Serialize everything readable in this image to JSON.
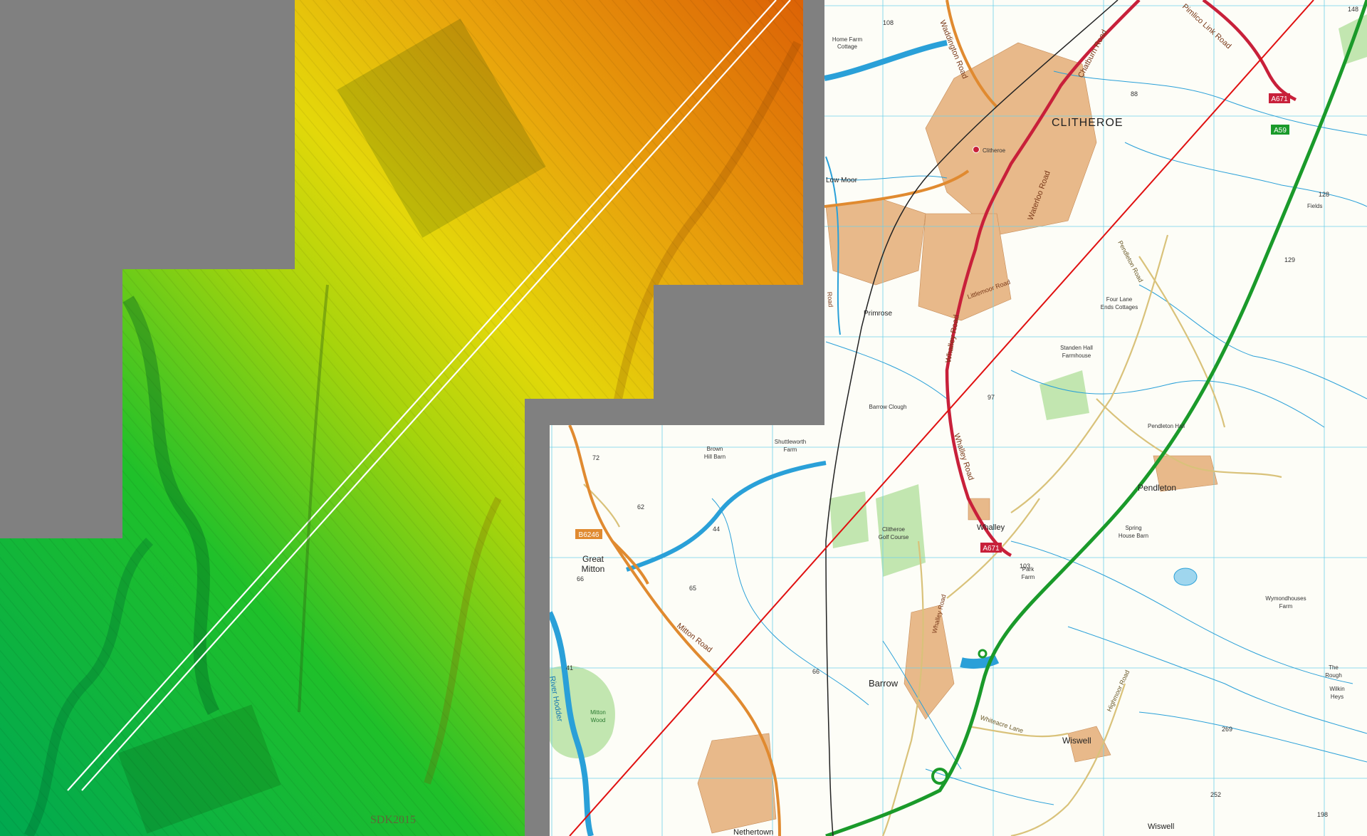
{
  "lidar_panel": {
    "watermark": "SDK2015",
    "colors": {
      "low": "#00b040",
      "mid": "#e8e000",
      "high": "#e0700a",
      "nodata": "#808080"
    }
  },
  "map_panel": {
    "colors": {
      "paper": "#fdfdf7",
      "grid": "#6fd0e8",
      "water": "#2aa0d8",
      "a_road": "#c8203a",
      "b_road": "#e08a30",
      "trunk": "#1a9a2a",
      "rail": "#222222",
      "pipeline": "#e01010",
      "urban": "#e8b98a",
      "woodland": "#c2e6b0"
    },
    "towns": {
      "clitheroe": "CLITHEROE",
      "barrow": "Barrow",
      "whalley": "Whalley",
      "pendleton": "Pendleton",
      "wiswell": "Wiswell",
      "wiswell2": "Wiswell",
      "great_mitton": [
        "Great",
        "Mitton"
      ],
      "low_moor": "Low Moor",
      "primrose": "Primrose",
      "nethertown": "Nethertown"
    },
    "places": {
      "home_farm": [
        "Home Farm",
        "Cottage"
      ],
      "clitheroe_station": "Clitheroe",
      "fields": "Fields",
      "four_lane": [
        "Four Lane",
        "Ends Cottages"
      ],
      "standen": [
        "Standen Hall",
        "Farmhouse"
      ],
      "barrow_clough": "Barrow Clough",
      "pendleton_hall": "Pendleton Hall",
      "brown_hill": [
        "Brown",
        "Hill Barn"
      ],
      "shuttleworth": [
        "Shuttleworth",
        "Farm"
      ],
      "golf": [
        "Clitheroe",
        "Golf Course"
      ],
      "spring_house": [
        "Spring",
        "House Barn"
      ],
      "park_farm": [
        "Park",
        "Farm"
      ],
      "wymondhouses": [
        "Wymondhouses",
        "Farm"
      ],
      "the_rough": [
        "The",
        "Rough"
      ],
      "wilkin": [
        "Wilkin",
        "Heys"
      ],
      "mitton_wood": [
        "Mitton",
        "Wood"
      ],
      "river_hodder": "River Hodder"
    },
    "roads": {
      "waddington": "Waddington Road",
      "chatburn": "Chatburn Road",
      "pimlico": "Pimlico Link Road",
      "waterloo": "Waterloo Road",
      "whalley_road_n": "Whalley Road",
      "whalley_road_s": "Whalley Road",
      "whalley_road_c": "Whalley Road",
      "mitton_road": "Mitton Road",
      "pendleton_road": "Pendleton Road",
      "whiteacre": "Whiteacre Lane",
      "lillie": "Littlemoor Road",
      "highmoor": "Highmoor Road",
      "york_road": "Road"
    },
    "shields": {
      "a671_top": "A671",
      "a59": "A59",
      "a671_whalley": "A671",
      "b6246": "B6246"
    },
    "spot_heights": [
      "108",
      "88",
      "128",
      "129",
      "97",
      "72",
      "62",
      "44",
      "66",
      "65",
      "41",
      "103",
      "66",
      "269",
      "252",
      "198",
      "148"
    ]
  }
}
